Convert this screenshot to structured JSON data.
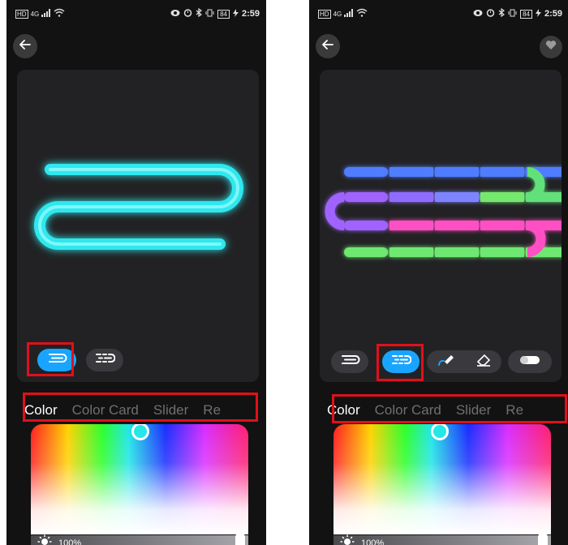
{
  "status_bar": {
    "time": "2:59",
    "battery": "84",
    "network": "4G",
    "icons": [
      "hd-icon",
      "signal-icon",
      "wifi-icon",
      "eye-icon",
      "alarm-icon",
      "bluetooth-icon",
      "vibrate-icon",
      "battery-icon",
      "charging-icon"
    ]
  },
  "left_screen": {
    "header": {
      "back_icon": "arrow-left-icon"
    },
    "strip_color": "#2ee8ee",
    "modes": [
      {
        "icon": "single-segment-icon",
        "active": true
      },
      {
        "icon": "multi-segment-icon",
        "active": false
      }
    ],
    "tabs": [
      "Color",
      "Color Card",
      "Slider",
      "Re"
    ],
    "active_tab": "Color",
    "brightness": {
      "value": "100%",
      "level": 1.0
    },
    "selected_color": "#27e6e8"
  },
  "right_screen": {
    "header": {
      "back_icon": "arrow-left-icon",
      "favorite_icon": "heart-icon"
    },
    "modes": [
      {
        "icon": "single-segment-icon",
        "active": false
      },
      {
        "icon": "multi-segment-icon",
        "active": true
      },
      {
        "icon": "paint-brush-icon",
        "active": false
      },
      {
        "icon": "eraser-icon",
        "active": false
      },
      {
        "icon": "toggle-icon",
        "active": false
      }
    ],
    "tabs": [
      "Color",
      "Color Card",
      "Slider",
      "Re"
    ],
    "active_tab": "Color",
    "brightness": {
      "value": "100%",
      "level": 1.0
    },
    "selected_color": "#27e6e8",
    "segment_colors": {
      "row1": [
        "#4f7dff",
        "#4f7dff",
        "#4f7dff",
        "#4f7dff",
        "#4f7dff",
        "#62e07a"
      ],
      "row2": [
        "#a064ff",
        "#8f6cff",
        "#7e84ff",
        "#74e86e",
        "#62e07a",
        "#62e07a"
      ],
      "row3": [
        "#a064ff",
        "#ff4fc4",
        "#ff4fc4",
        "#ff4fc4",
        "#ff4fc4",
        "#ff4fc4"
      ],
      "row4": [
        "#6ee870",
        "#6ee870",
        "#6ee870",
        "#6ee870",
        "#6ee870",
        "#6ee870"
      ]
    }
  }
}
